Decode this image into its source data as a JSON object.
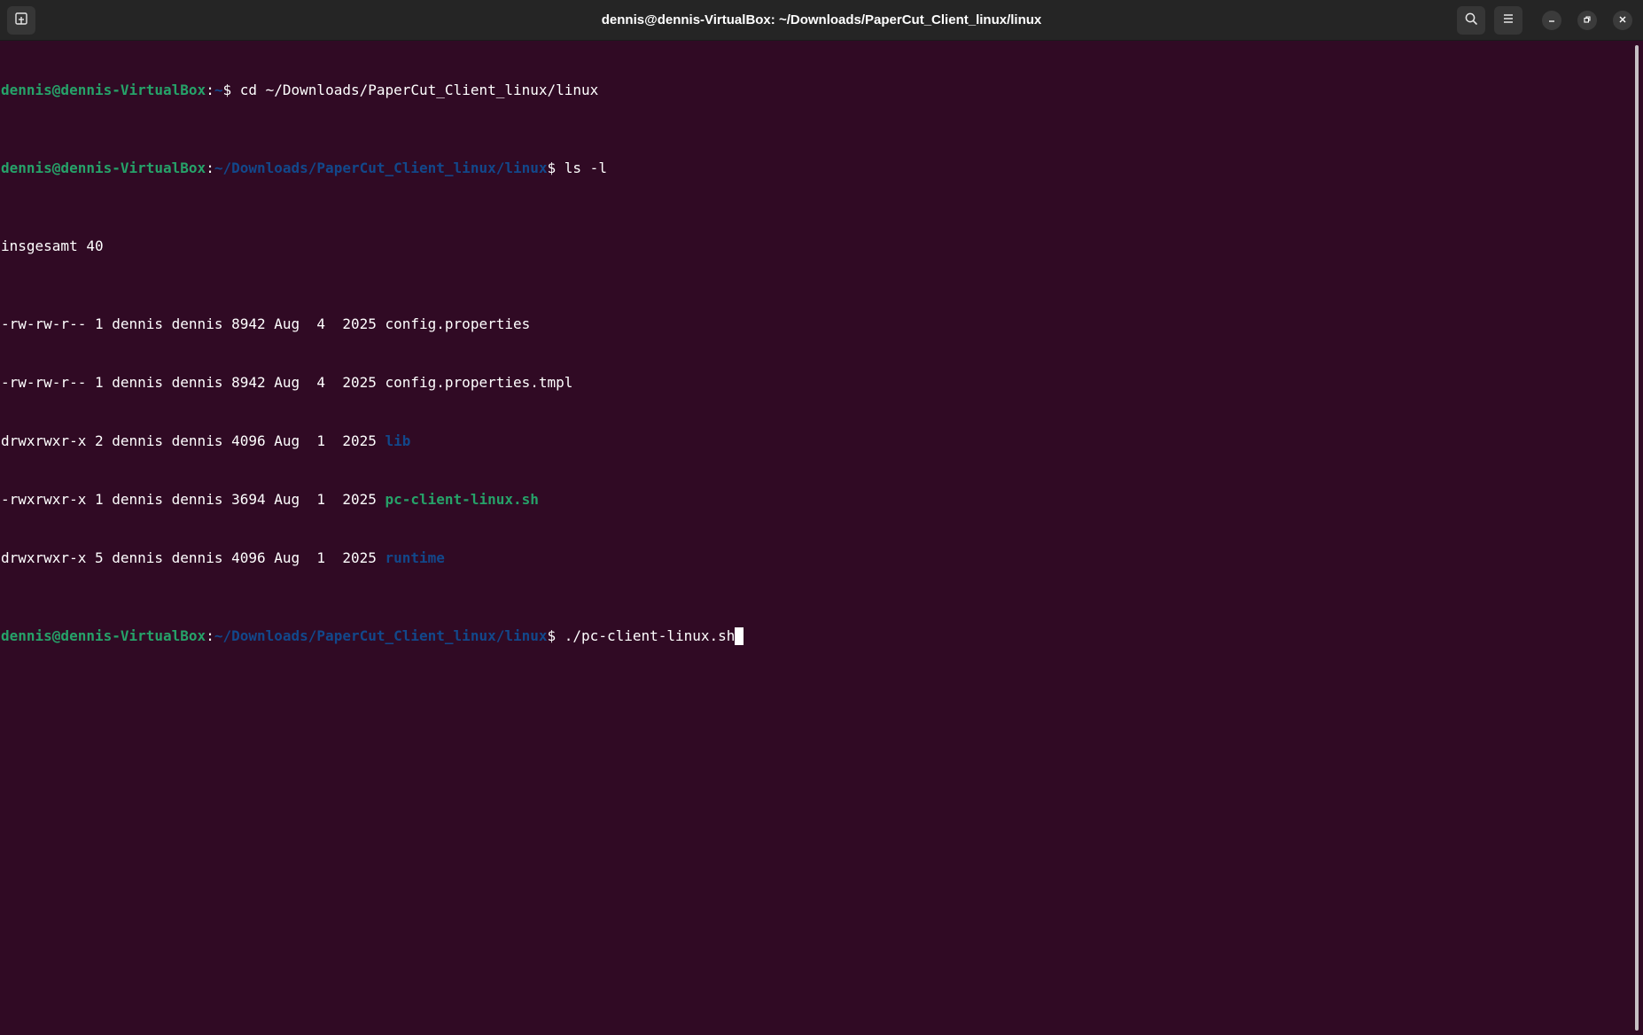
{
  "window": {
    "title": "dennis@dennis-VirtualBox: ~/Downloads/PaperCut_Client_linux/linux"
  },
  "titlebar_icons": {
    "new_tab": "new-tab-icon",
    "search": "search-icon",
    "menu": "hamburger-menu-icon",
    "minimize": "minimize-icon",
    "maximize": "restore-icon",
    "close": "close-icon"
  },
  "colors": {
    "background": "#300a24",
    "prompt_user": "#26a269",
    "prompt_path": "#12488b",
    "text": "#ffffff"
  },
  "terminal": {
    "prompt_user": "dennis@dennis-VirtualBox",
    "line1": {
      "path": "~",
      "command": "cd ~/Downloads/PaperCut_Client_linux/linux"
    },
    "line2": {
      "path": "~/Downloads/PaperCut_Client_linux/linux",
      "command": "ls -l"
    },
    "total": "insgesamt 40",
    "files": [
      {
        "meta": "-rw-rw-r-- 1 dennis dennis 8942 Aug  4  2025 ",
        "name": "config.properties"
      },
      {
        "meta": "-rw-rw-r-- 1 dennis dennis 8942 Aug  4  2025 ",
        "name": "config.properties.tmpl"
      },
      {
        "meta": "drwxrwxr-x 2 dennis dennis 4096 Aug  1  2025 ",
        "name": "lib"
      },
      {
        "meta": "-rwxrwxr-x 1 dennis dennis 3694 Aug  1  2025 ",
        "name": "pc-client-linux.sh"
      },
      {
        "meta": "drwxrwxr-x 5 dennis dennis 4096 Aug  1  2025 ",
        "name": "runtime"
      }
    ],
    "line3": {
      "path": "~/Downloads/PaperCut_Client_linux/linux",
      "command": "./pc-client-linux.sh"
    }
  }
}
